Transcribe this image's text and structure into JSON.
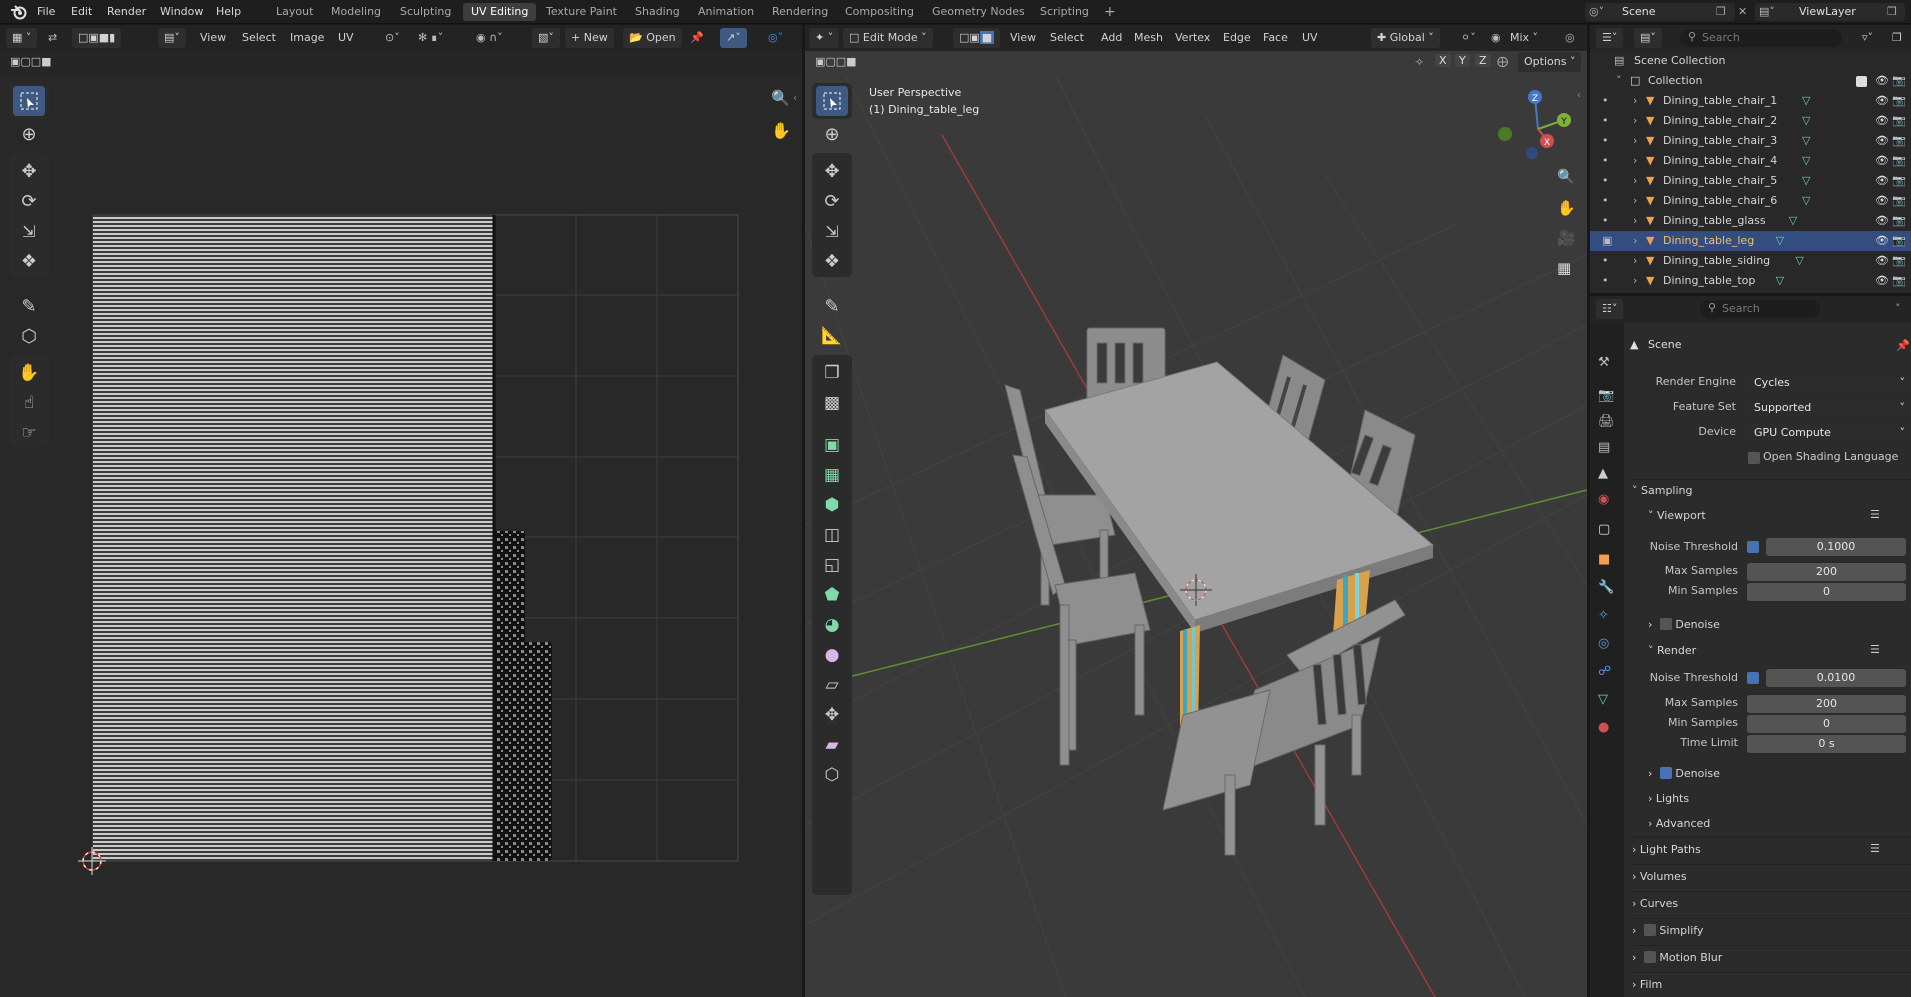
{
  "topbar": {
    "menus": [
      "File",
      "Edit",
      "Render",
      "Window",
      "Help"
    ],
    "workspaces": [
      "Layout",
      "Modeling",
      "Sculpting",
      "UV Editing",
      "Texture Paint",
      "Shading",
      "Animation",
      "Rendering",
      "Compositing",
      "Geometry Nodes",
      "Scripting"
    ],
    "active_workspace": "UV Editing",
    "add_tab": "+",
    "scene": "Scene",
    "view_layer": "ViewLayer"
  },
  "uv_editor": {
    "menus": [
      "View",
      "Select",
      "Image",
      "UV"
    ],
    "new_label": "New",
    "open_label": "Open"
  },
  "viewport": {
    "mode": "Edit Mode",
    "menus": [
      "View",
      "Select",
      "Add",
      "Mesh",
      "Vertex",
      "Edge",
      "Face",
      "UV"
    ],
    "orientation": "Global",
    "blend": "Mix",
    "options_label": "Options",
    "axis_x": "X",
    "axis_y": "Y",
    "axis_z": "Z",
    "overlay_title": "User Perspective",
    "overlay_object": "(1) Dining_table_leg",
    "gizmo_z": "Z",
    "gizmo_y": "Y",
    "gizmo_x": "X"
  },
  "outliner": {
    "search_placeholder": "Search",
    "scene_collection": "Scene Collection",
    "collection": "Collection",
    "objects": [
      {
        "name": "Dining_table_chair_1",
        "selected": false
      },
      {
        "name": "Dining_table_chair_2",
        "selected": false
      },
      {
        "name": "Dining_table_chair_3",
        "selected": false
      },
      {
        "name": "Dining_table_chair_4",
        "selected": false
      },
      {
        "name": "Dining_table_chair_5",
        "selected": false
      },
      {
        "name": "Dining_table_chair_6",
        "selected": false
      },
      {
        "name": "Dining_table_glass",
        "selected": false
      },
      {
        "name": "Dining_table_leg",
        "selected": true
      },
      {
        "name": "Dining_table_siding",
        "selected": false
      },
      {
        "name": "Dining_table_top",
        "selected": false
      }
    ]
  },
  "properties": {
    "search_placeholder": "Search",
    "context": "Scene",
    "render_engine_label": "Render Engine",
    "render_engine": "Cycles",
    "feature_set_label": "Feature Set",
    "feature_set": "Supported",
    "device_label": "Device",
    "device": "GPU Compute",
    "osl_label": "Open Shading Language",
    "sampling": "Sampling",
    "viewport": "Viewport",
    "noise_threshold_label": "Noise Threshold",
    "viewport_noise_threshold": "0.1000",
    "max_samples_label": "Max Samples",
    "viewport_max_samples": "200",
    "min_samples_label": "Min Samples",
    "viewport_min_samples": "0",
    "denoise_label": "Denoise",
    "render": "Render",
    "render_noise_threshold": "0.0100",
    "render_max_samples": "200",
    "render_min_samples": "0",
    "time_limit_label": "Time Limit",
    "time_limit": "0 s",
    "lights": "Lights",
    "advanced": "Advanced",
    "light_paths": "Light Paths",
    "volumes": "Volumes",
    "curves": "Curves",
    "simplify": "Simplify",
    "motion_blur": "Motion Blur",
    "film": "Film"
  }
}
